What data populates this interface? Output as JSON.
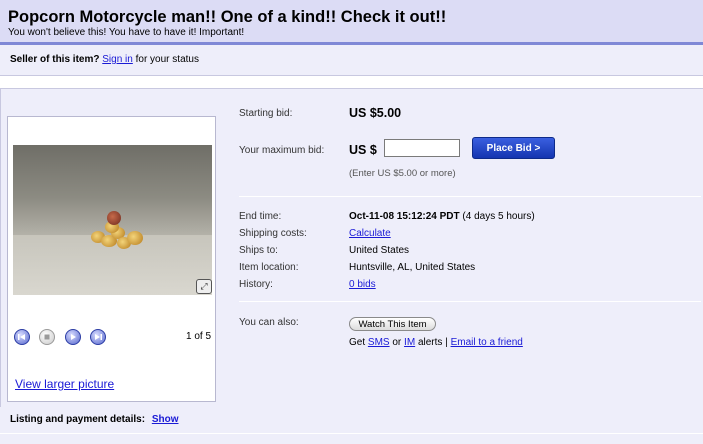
{
  "header": {
    "title": "Popcorn Motorcycle man!! One of a kind!! Check it out!!",
    "subtitle": "You won't believe this! You have to have it! Important!"
  },
  "seller": {
    "prefix": "Seller of this item?",
    "link": "Sign in",
    "suffix": "for your status"
  },
  "gallery": {
    "counter": "1 of 5",
    "view_larger": "View larger picture",
    "controls": [
      "previous-icon",
      "stop-icon",
      "play-icon",
      "next-icon"
    ]
  },
  "bid": {
    "starting_label": "Starting bid:",
    "starting_value": "US $5.00",
    "max_label": "Your maximum bid:",
    "currency": "US $",
    "input_value": "",
    "button": "Place Bid >",
    "hint": "(Enter US $5.00 or more)"
  },
  "details": {
    "end_time_label": "End time:",
    "end_time_value": "Oct-11-08 15:12:24 PDT",
    "end_time_remaining": "(4 days 5 hours)",
    "shipping_label": "Shipping costs:",
    "shipping_link": "Calculate",
    "ships_to_label": "Ships to:",
    "ships_to_value": "United States",
    "location_label": "Item location:",
    "location_value": "Huntsville, AL, United States",
    "history_label": "History:",
    "history_link": "0 bids"
  },
  "also": {
    "label": "You can also:",
    "watch_button": "Watch This Item",
    "get": "Get",
    "sms": "SMS",
    "or": "or",
    "im": "IM",
    "alerts": "alerts |",
    "email": "Email to a friend"
  },
  "listing": {
    "label": "Listing and payment details:",
    "show": "Show"
  },
  "colors": {
    "title_bar": "#dcdcf5",
    "title_rule": "#7f88d6",
    "panel_bg": "#eeeefa",
    "link": "#1a1ad6",
    "bid_button": "#1435b0"
  }
}
